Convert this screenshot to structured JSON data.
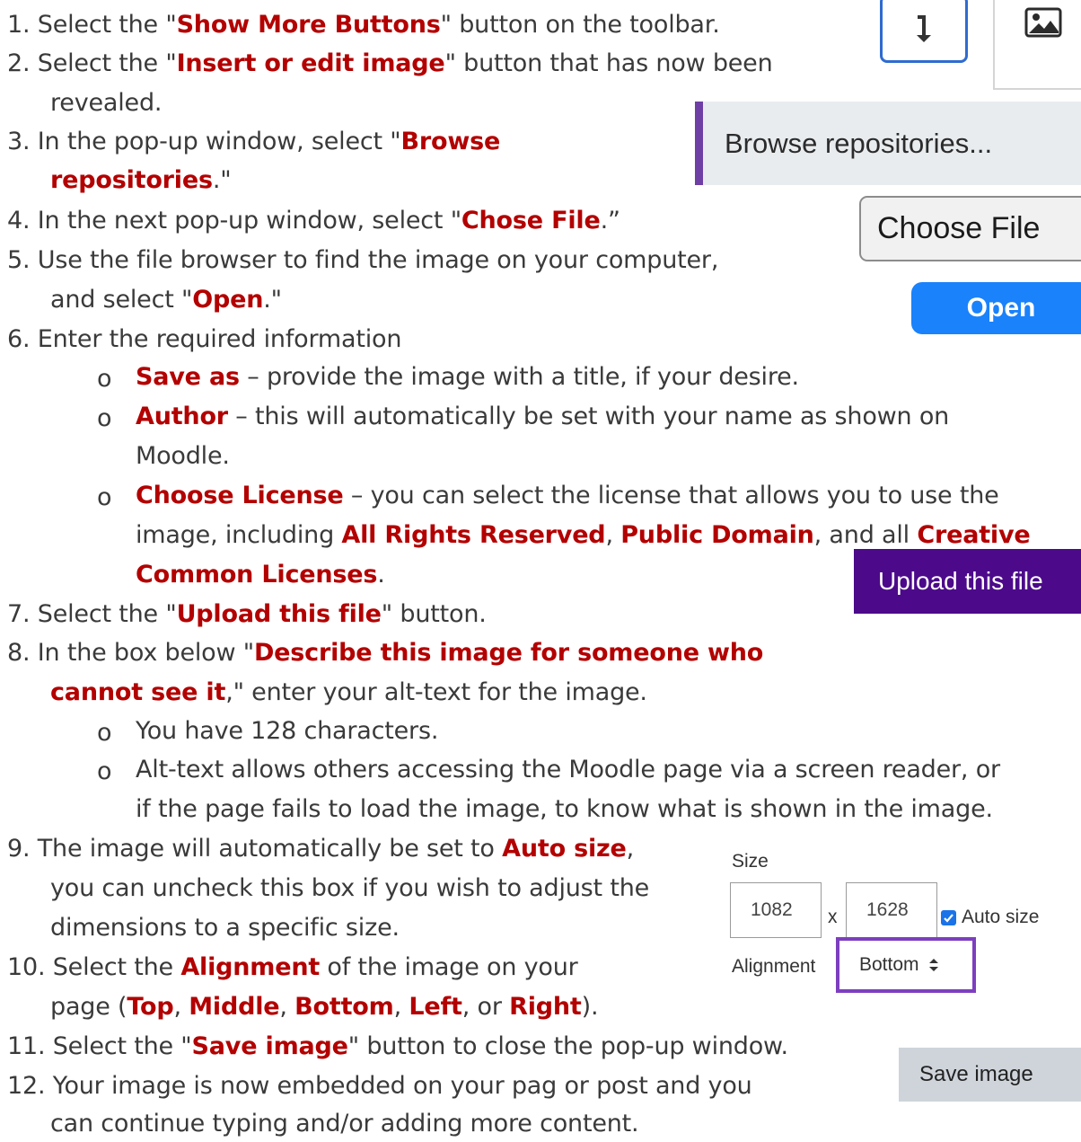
{
  "steps": {
    "s1": {
      "num": "1.",
      "a": "Select the \"",
      "b": "Show More Buttons",
      "c": "\" button on the toolbar."
    },
    "s2": {
      "num": "2.",
      "a": "Select the \"",
      "b": "Insert or edit image",
      "c": "\" button that has now been",
      "d": "revealed."
    },
    "s3": {
      "num": "3.",
      "a": "In the pop-up window, select \"",
      "b": "Browse",
      "b2": "repositories",
      "c": ".\""
    },
    "s4": {
      "num": "4.",
      "a": "In the next pop-up window, select \"",
      "b": "Chose File",
      "c": ".”"
    },
    "s5": {
      "num": "5.",
      "a": "Use the file browser to find the image on your computer,",
      "a2": "and select \"",
      "b": "Open",
      "c": ".\""
    },
    "s6": {
      "num": "6.",
      "a": "Enter the required information"
    },
    "s6_bullets": {
      "marker": "o",
      "b1": {
        "k": "Save as",
        "t": " – provide the image with a title, if your desire."
      },
      "b2": {
        "k": "Author",
        "t": " – this will automatically be set with your name as shown on",
        "t2": "Moodle."
      },
      "b3": {
        "k": "Choose License",
        "t": " – you can select the license that allows you to use the",
        "t2a": "image, including ",
        "k2": "All Rights Reserved",
        "sep1": ", ",
        "k3": "Public Domain",
        "sep2": ", and all ",
        "k4": "Creative",
        "k5": "Common Licenses",
        "end": "."
      }
    },
    "s7": {
      "num": "7.",
      "a": "Select the \"",
      "b": "Upload this file",
      "c": "\" button."
    },
    "s8": {
      "num": "8.",
      "a": "In the box below \"",
      "b": "Describe this image for someone who",
      "b2": "cannot see it",
      "c": ",\" enter your alt-text for the image."
    },
    "s8_bullets": {
      "b1": "You have 128 characters.",
      "b2": "Alt-text allows others accessing the Moodle page via a screen reader, or",
      "b2b": "if the page fails to load the image, to know what is shown in the image."
    },
    "s9": {
      "num": "9.",
      "a": "The image will automatically be set to ",
      "b": "Auto size",
      "c": ",",
      "l2": "you can uncheck this box if you wish to adjust the",
      "l3": "dimensions to a specific size."
    },
    "s10": {
      "num": "10.",
      "a": "Select the ",
      "b": "Alignment",
      "c": " of the  image on your",
      "l2a": "page (",
      "o1": "Top",
      "sep": ", ",
      "o2": "Middle",
      "o3": "Bottom",
      "o4": "Left",
      "or": ", or ",
      "o5": "Right",
      "end": ")."
    },
    "s11": {
      "num": "11.",
      "a": "Select the \"",
      "b": "Save image",
      "c": "\" button to close the pop-up window."
    },
    "s12": {
      "num": "12.",
      "a": "Your image is now embedded on your pag or post and you",
      "l2": "can continue typing and/or adding more content."
    }
  },
  "ui": {
    "browse_label": "Browse repositories...",
    "choose_label": "Choose File",
    "open_label": "Open",
    "upload_label": "Upload this file",
    "size_label": "Size",
    "width_value": "1082",
    "x_sep": "x",
    "height_value": "1628",
    "autosize_label": "Auto size",
    "alignment_label": "Alignment",
    "alignment_value": "Bottom",
    "alignment_caret": "⬍",
    "save_label": "Save image",
    "toolbar_icons": [
      "arrow-down-icon",
      "image-icon"
    ]
  },
  "colors": {
    "emphasis": "#b30000",
    "browse_bar": "#6e3fa5",
    "open_btn": "#1a82fb",
    "upload_btn": "#4c0a8a",
    "toolbar_active": "#2f6bd0"
  }
}
